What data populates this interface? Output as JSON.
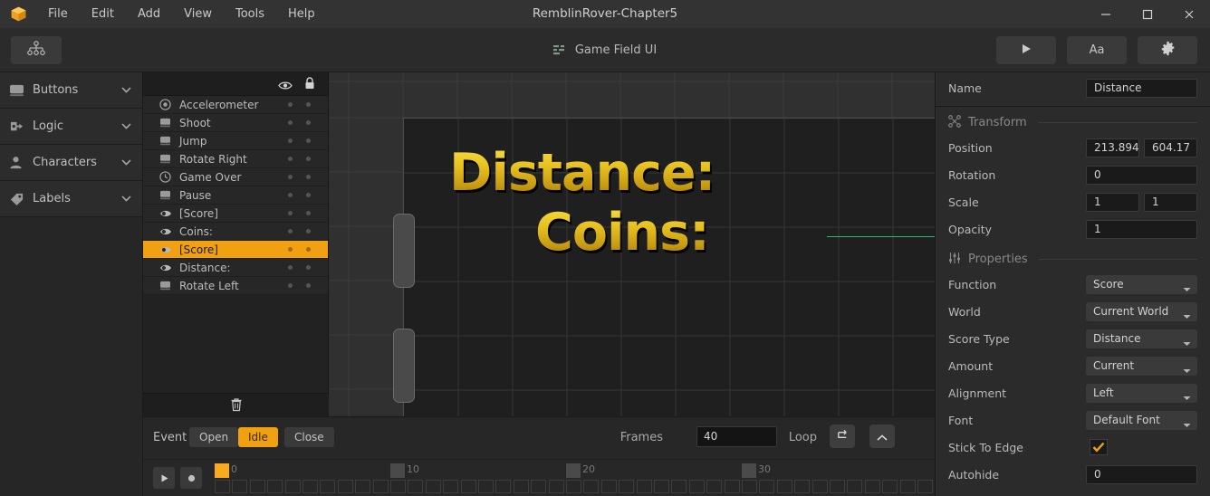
{
  "window": {
    "title": "RemblinRover-Chapter5",
    "minimize_icon": "minimize-icon",
    "maximize_icon": "maximize-icon",
    "close_icon": "close-icon"
  },
  "menubar": {
    "logo": "app-logo",
    "items": [
      "File",
      "Edit",
      "Add",
      "View",
      "Tools",
      "Help"
    ]
  },
  "toolbar": {
    "hierarchy_icon": "hierarchy-icon",
    "doc_icon": "list-icon",
    "doc_title": "Game Field UI",
    "play_label": "▶",
    "text_label": "Aa",
    "settings_label": "⚙"
  },
  "sidebar": {
    "items": [
      {
        "label": "Buttons",
        "icon": "button-icon"
      },
      {
        "label": "Logic",
        "icon": "logic-icon"
      },
      {
        "label": "Characters",
        "icon": "character-icon"
      },
      {
        "label": "Labels",
        "icon": "label-tag-icon"
      }
    ]
  },
  "layers": {
    "header": {
      "visibility_icon": "eye-icon",
      "lock_icon": "lock-icon"
    },
    "delete_icon": "trash-icon",
    "items": [
      {
        "name": "Accelerometer",
        "icon": "accelerometer-icon",
        "selected": false
      },
      {
        "name": "Shoot",
        "icon": "button-icon",
        "selected": false
      },
      {
        "name": "Jump",
        "icon": "button-icon",
        "selected": false
      },
      {
        "name": "Rotate Right",
        "icon": "button-icon",
        "selected": false
      },
      {
        "name": "Game Over",
        "icon": "clock-icon",
        "selected": false
      },
      {
        "name": "Pause",
        "icon": "button-icon",
        "selected": false
      },
      {
        "name": "[Score]",
        "icon": "label-icon",
        "selected": false
      },
      {
        "name": "Coins:",
        "icon": "label-icon",
        "selected": false
      },
      {
        "name": "[Score]",
        "icon": "label-icon",
        "selected": true
      },
      {
        "name": "Distance:",
        "icon": "label-icon",
        "selected": false
      },
      {
        "name": "Rotate Left",
        "icon": "button-icon",
        "selected": false
      }
    ]
  },
  "canvas": {
    "texts": [
      {
        "value": "Distance:"
      },
      {
        "value": "Coins:"
      }
    ]
  },
  "timeline": {
    "event_label": "Event",
    "events": [
      {
        "label": "Open",
        "active": false
      },
      {
        "label": "Idle",
        "active": true
      },
      {
        "label": "Close",
        "active": false
      }
    ],
    "frames_label": "Frames",
    "frames_value": "40",
    "loop_label": "Loop",
    "loop_icon": "loop-icon",
    "collapse_icon": "chevron-up-icon",
    "play_icon": "play-icon",
    "record_icon": "record-icon",
    "ruler_ticks": [
      "0",
      "10",
      "20",
      "30"
    ],
    "frame_count": 44,
    "current_frame": 0
  },
  "properties": {
    "name_label": "Name",
    "name_value": "Distance",
    "transform": {
      "title": "Transform",
      "icon": "transform-icon",
      "rows": [
        {
          "label": "Position",
          "values": [
            "213.894",
            "604.17"
          ]
        },
        {
          "label": "Rotation",
          "values": [
            "0"
          ]
        },
        {
          "label": "Scale",
          "values": [
            "1",
            "1"
          ]
        },
        {
          "label": "Opacity",
          "values": [
            "1"
          ]
        }
      ]
    },
    "props": {
      "title": "Properties",
      "icon": "sliders-icon",
      "rows": [
        {
          "label": "Function",
          "type": "dropdown",
          "value": "Score"
        },
        {
          "label": "World",
          "type": "dropdown",
          "value": "Current World"
        },
        {
          "label": "Score Type",
          "type": "dropdown",
          "value": "Distance"
        },
        {
          "label": "Amount",
          "type": "dropdown",
          "value": "Current"
        },
        {
          "label": "Alignment",
          "type": "dropdown",
          "value": "Left"
        },
        {
          "label": "Font",
          "type": "dropdown",
          "value": "Default Font"
        },
        {
          "label": "Stick To Edge",
          "type": "checkbox",
          "value": "checked"
        },
        {
          "label": "Autohide",
          "type": "text",
          "value": "0"
        }
      ]
    }
  },
  "colors": {
    "accent": "#f0a010",
    "selection": "#4fc3e8",
    "anchor": "#2eb86a"
  }
}
